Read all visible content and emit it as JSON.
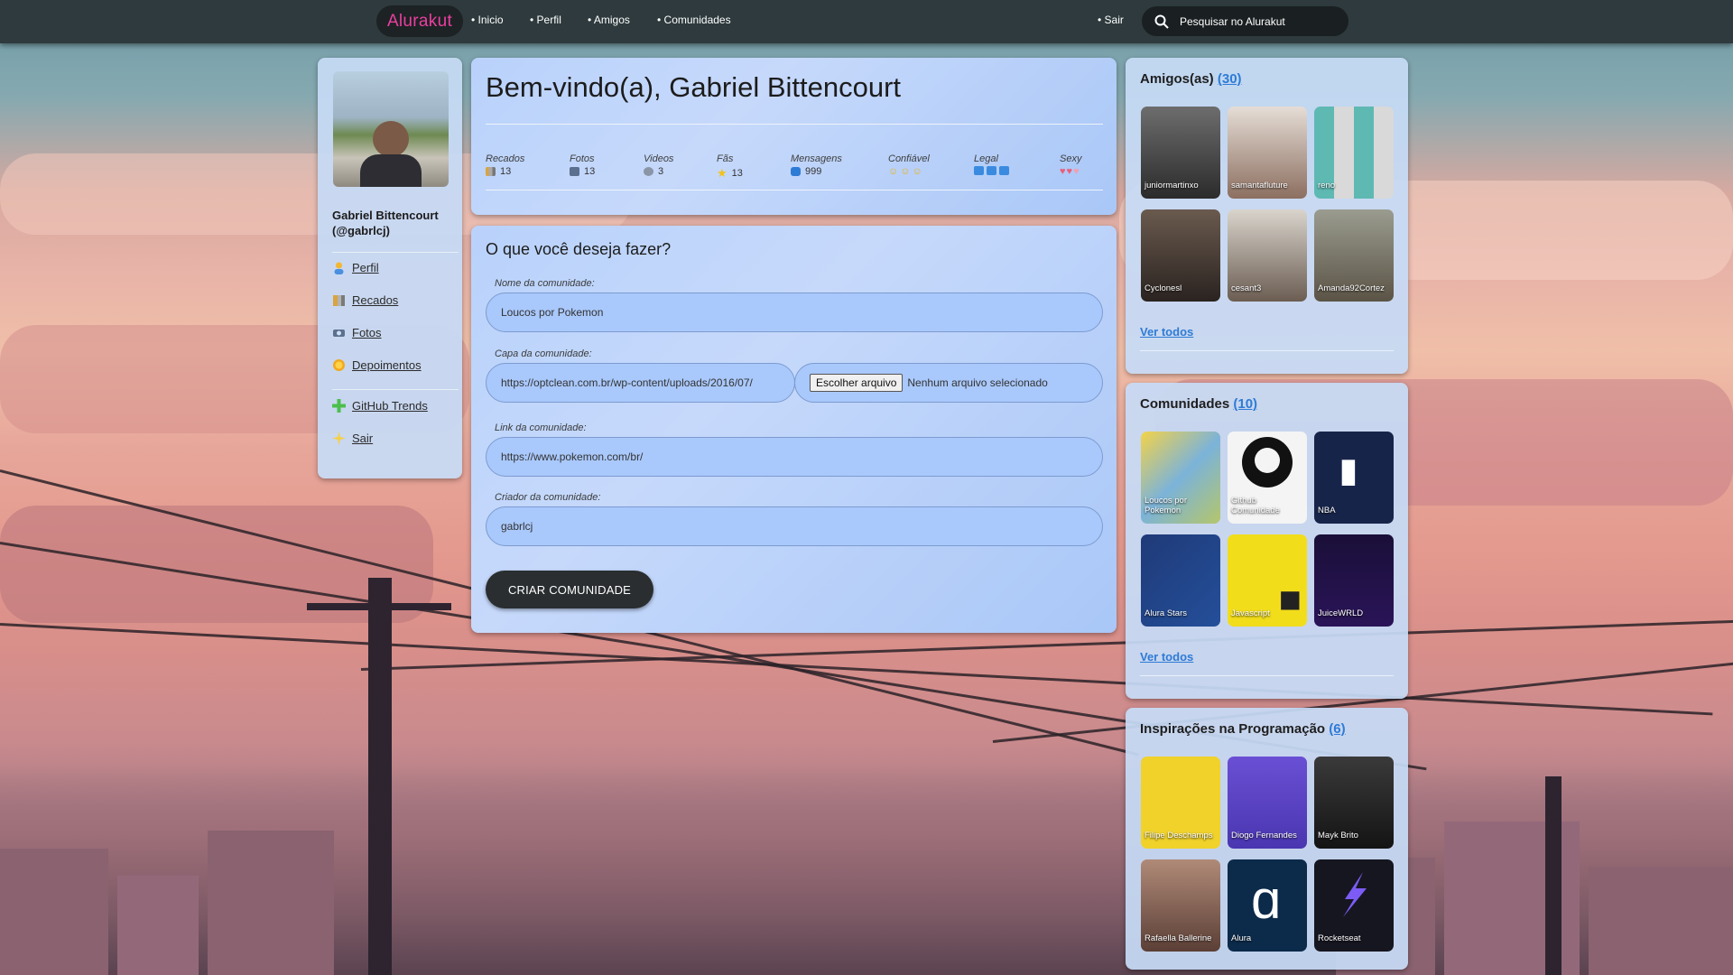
{
  "nav": {
    "logo": "Alurakut",
    "links": [
      "Inicio",
      "Perfil",
      "Amigos",
      "Comunidades"
    ],
    "logout": "Sair",
    "search_placeholder": "Pesquisar no Alurakut"
  },
  "sidebar": {
    "name": "Gabriel Bittencourt (@gabrlcj)",
    "items": [
      {
        "label": "Perfil",
        "icon": "user-icon"
      },
      {
        "label": "Recados",
        "icon": "book-icon"
      },
      {
        "label": "Fotos",
        "icon": "camera-icon"
      },
      {
        "label": "Depoimentos",
        "icon": "sun-icon"
      },
      {
        "label": "GitHub Trends",
        "icon": "plus-icon"
      },
      {
        "label": "Sair",
        "icon": "sparkle-icon"
      }
    ]
  },
  "welcome": {
    "title": "Bem-vindo(a), Gabriel Bittencourt",
    "stats": [
      {
        "label": "Recados",
        "value": "13"
      },
      {
        "label": "Fotos",
        "value": "13"
      },
      {
        "label": "Videos",
        "value": "3"
      },
      {
        "label": "Fãs",
        "value": "13"
      },
      {
        "label": "Mensagens",
        "value": "999"
      },
      {
        "label": "Confiável",
        "value": ""
      },
      {
        "label": "Legal",
        "value": ""
      },
      {
        "label": "Sexy",
        "value": ""
      }
    ]
  },
  "form": {
    "title": "O que você deseja fazer?",
    "name_label": "Nome da comunidade:",
    "name_value": "Loucos por Pokemon",
    "cover_label": "Capa da comunidade:",
    "cover_value": "https://optclean.com.br/wp-content/uploads/2016/07/",
    "file_button": "Escolher arquivo",
    "file_status": "Nenhum arquivo selecionado",
    "link_label": "Link da comunidade:",
    "link_value": "https://www.pokemon.com/br/",
    "creator_label": "Criador da comunidade:",
    "creator_value": "gabrlcj",
    "submit": "CRIAR COMUNIDADE"
  },
  "friends": {
    "title": "Amigos(as)",
    "count": "(30)",
    "items": [
      "juniormartinxo",
      "samantafluture",
      "reno",
      "Cyclonesl",
      "cesant3",
      "Amanda92Cortez"
    ],
    "see_all": "Ver todos"
  },
  "communities": {
    "title": "Comunidades",
    "count": "(10)",
    "items": [
      "Loucos por Pokemon",
      "Github Comunidade",
      "NBA",
      "Alura Stars",
      "Javascript",
      "JuiceWRLD"
    ],
    "see_all": "Ver todos"
  },
  "inspirations": {
    "title": "Inspirações na Programação",
    "count": "(6)",
    "items": [
      "Filipe Deschamps",
      "Diogo Fernandes",
      "Mayk Brito",
      "Rafaella Ballerine",
      "Alura",
      "Rocketseat"
    ]
  }
}
